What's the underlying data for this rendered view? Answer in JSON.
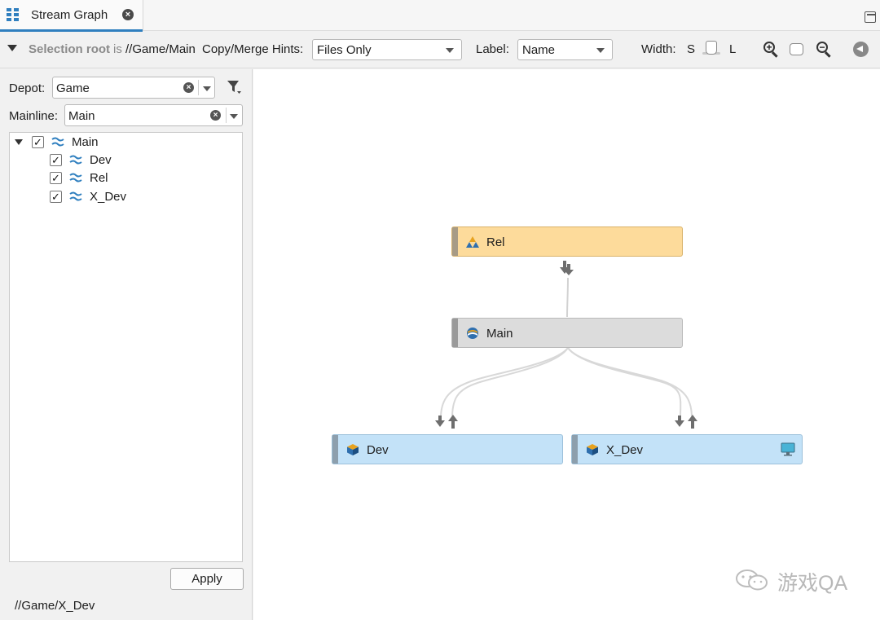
{
  "tab": {
    "title": "Stream Graph",
    "close": "×"
  },
  "toolbar": {
    "selection_root_label": "Selection root",
    "selection_root_is": "is",
    "selection_root_value": "//Game/Main",
    "hints_label": "Copy/Merge Hints:",
    "hints_value": "Files Only",
    "label_label": "Label:",
    "label_value": "Name",
    "width_label": "Width:",
    "width_small": "S",
    "width_large": "L"
  },
  "filters": {
    "depot_label": "Depot:",
    "depot_value": "Game",
    "mainline_label": "Mainline:",
    "mainline_value": "Main",
    "clear": "×"
  },
  "tree": {
    "items": [
      {
        "label": "Main",
        "checked": "✓"
      },
      {
        "label": "Dev",
        "checked": "✓"
      },
      {
        "label": "Rel",
        "checked": "✓"
      },
      {
        "label": "X_Dev",
        "checked": "✓"
      }
    ]
  },
  "apply_label": "Apply",
  "status_path": "//Game/X_Dev",
  "graph": {
    "nodes": {
      "rel": "Rel",
      "main": "Main",
      "dev": "Dev",
      "x_dev": "X_Dev"
    },
    "colors": {
      "release": "#fddb9b",
      "mainline": "#dcdcdc",
      "development": "#c3e2f8",
      "accent": "#2f7fbf"
    }
  },
  "watermark": "游戏QA"
}
